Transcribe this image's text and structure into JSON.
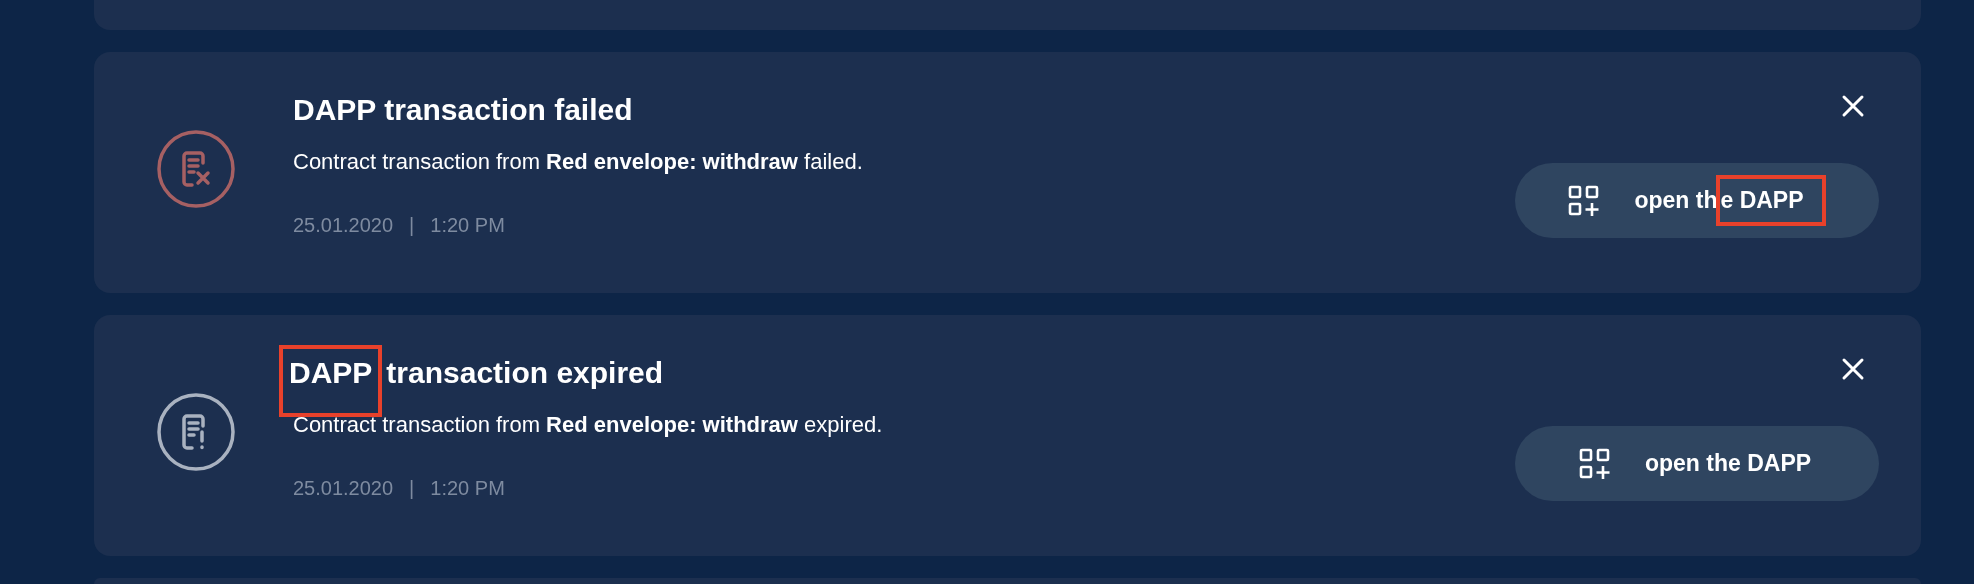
{
  "notifications": [
    {
      "kind": "failed",
      "title_parts": [
        {
          "text": "DAPP transaction failed",
          "highlighted": false
        }
      ],
      "message": "Contract transaction from **Red envelope: withdraw** failed.",
      "date": "25.01.2020",
      "separator": "|",
      "time": "1:20 PM",
      "button_parts": [
        {
          "text": "open th",
          "highlighted": false
        },
        {
          "text": "e DAPP",
          "highlighted": true
        }
      ]
    },
    {
      "kind": "expired",
      "title_parts": [
        {
          "text": "DAPP",
          "highlighted": true
        },
        {
          "text": "transaction expired",
          "highlighted": false
        }
      ],
      "message": "Contract transaction from **Red envelope: withdraw** expired.",
      "date": "25.01.2020",
      "separator": "|",
      "time": "1:20 PM",
      "button_parts": [
        {
          "text": "open the DAPP",
          "highlighted": false
        }
      ]
    }
  ]
}
